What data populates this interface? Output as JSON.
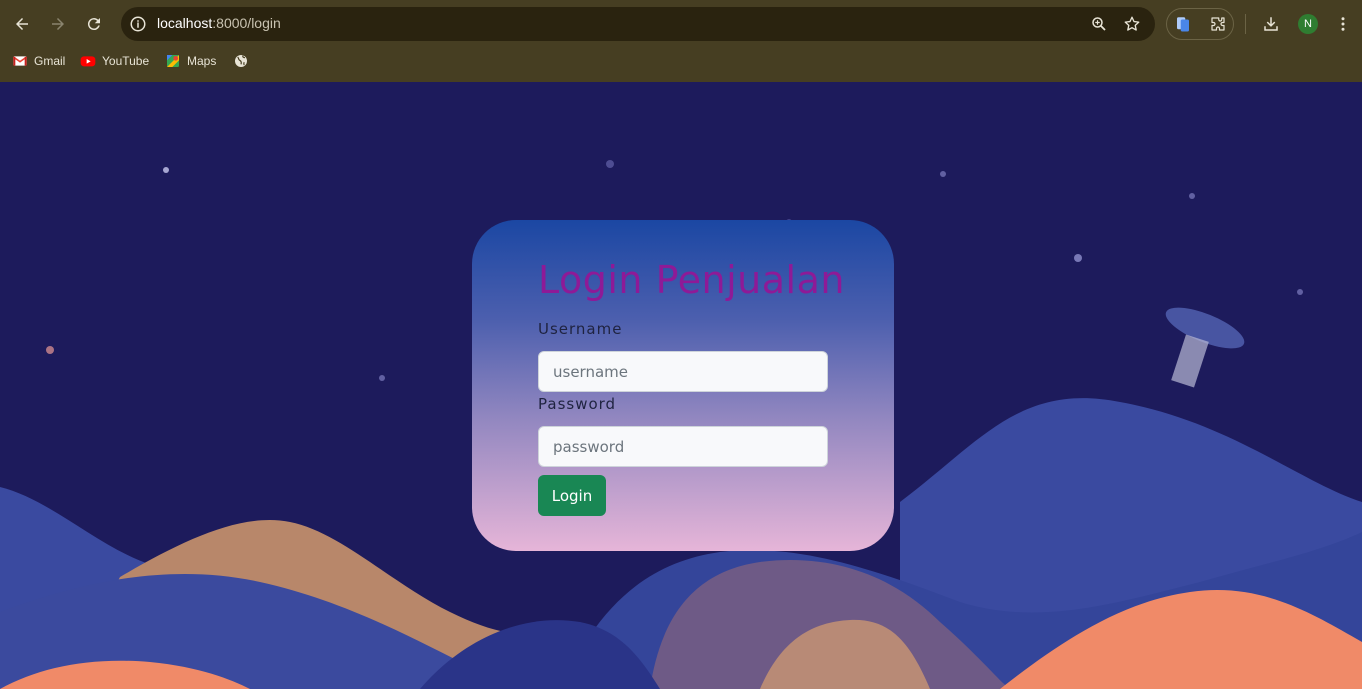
{
  "browser": {
    "url_host": "localhost",
    "url_path": ":8000/login",
    "bookmarks": [
      {
        "label": "Gmail",
        "icon": "gmail-icon"
      },
      {
        "label": "YouTube",
        "icon": "youtube-icon"
      },
      {
        "label": "Maps",
        "icon": "maps-icon"
      },
      {
        "label": "",
        "icon": "globe-icon"
      }
    ],
    "profile_initial": "N",
    "colors": {
      "toolbar": "#463e22",
      "omnibox": "#2a230f"
    }
  },
  "login": {
    "title": "Login Penjualan",
    "username_label": "Username",
    "username_placeholder": "username",
    "username_value": "",
    "password_label": "Password",
    "password_placeholder": "password",
    "password_value": "",
    "submit_label": "Login",
    "colors": {
      "title": "#8e1a97",
      "button": "#198754",
      "card_top": "#1b47a3",
      "card_bottom": "#e6b5d8"
    }
  },
  "background": {
    "sky_color": "#1d1b5c"
  }
}
